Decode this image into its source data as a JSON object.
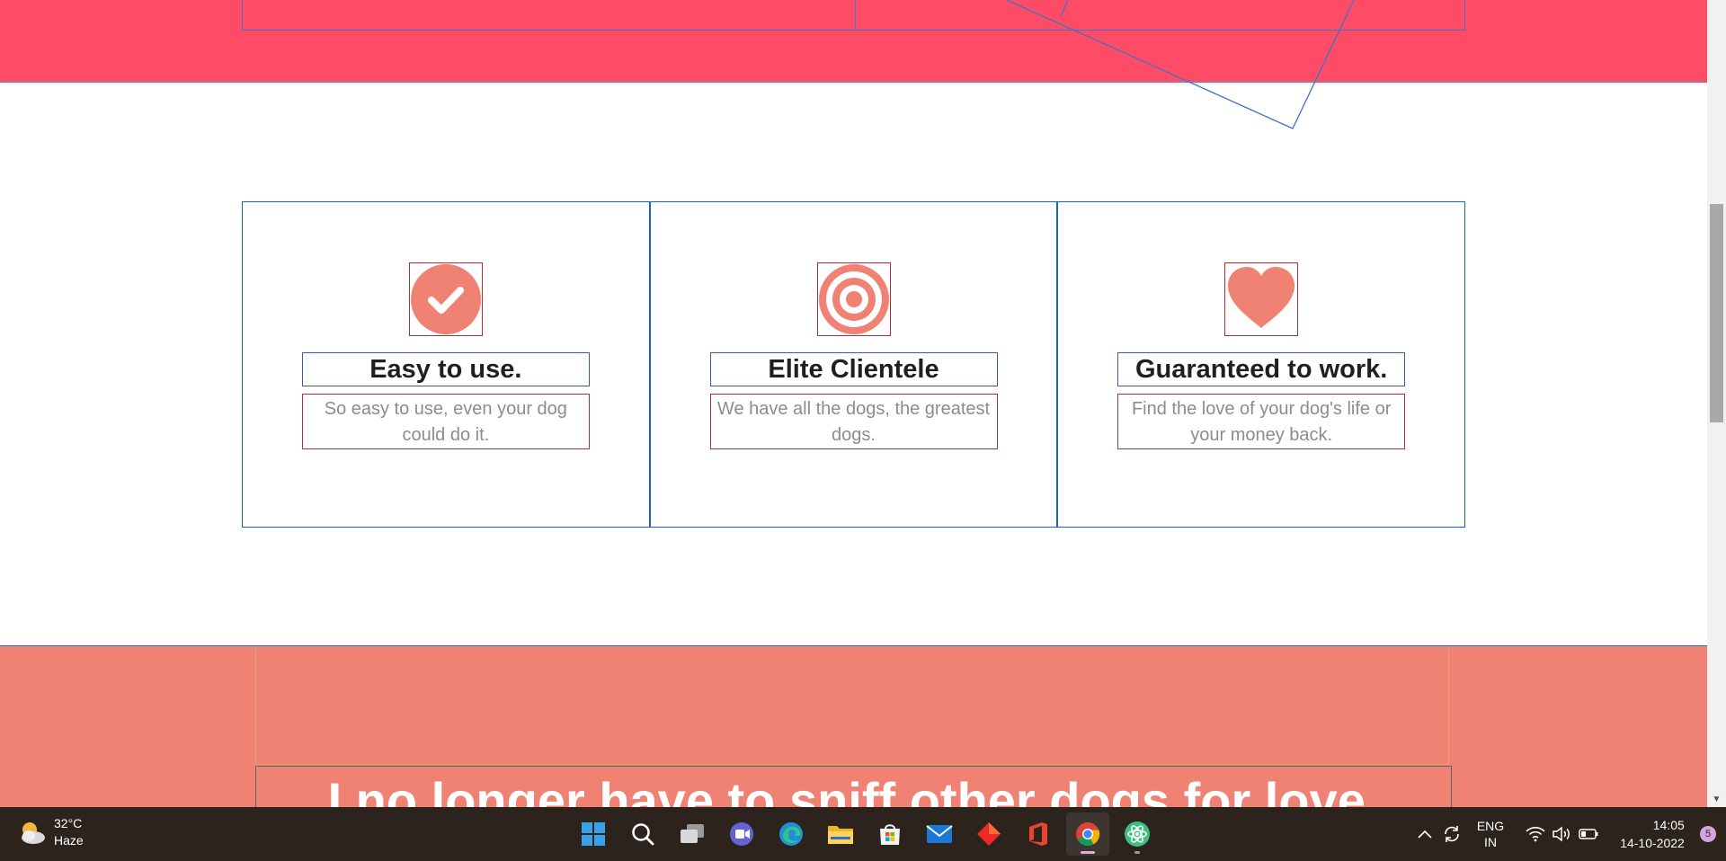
{
  "features": [
    {
      "icon": "checkmark-circle-icon",
      "title": "Easy to use.",
      "description": "So easy to use, even your dog could do it."
    },
    {
      "icon": "target-icon",
      "title": "Elite Clientele",
      "description": "We have all the dogs, the greatest dogs."
    },
    {
      "icon": "heart-icon",
      "title": "Guaranteed to work.",
      "description": "Find the love of your dog's life or your money back."
    }
  ],
  "testimonial": {
    "text": "I no longer have to sniff other dogs for love."
  },
  "colors": {
    "top_band": "#fe4b66",
    "accent_icon": "#ef8273",
    "bottom_band": "#ef8273",
    "outline_blue": "#1a66b5"
  },
  "taskbar": {
    "weather": {
      "temperature": "32°C",
      "condition": "Haze",
      "icon": "weather-haze-icon"
    },
    "apps": [
      "windows-start-icon",
      "search-icon",
      "task-view-icon",
      "teams-chat-icon",
      "edge-icon",
      "file-explorer-icon",
      "microsoft-store-icon",
      "mail-icon",
      "red-diamond-app-icon",
      "office-icon",
      "chrome-icon",
      "atom-icon"
    ],
    "language": {
      "line1": "ENG",
      "line2": "IN"
    },
    "clock": {
      "time": "14:05",
      "date": "14-10-2022"
    },
    "notification_count": "5"
  }
}
